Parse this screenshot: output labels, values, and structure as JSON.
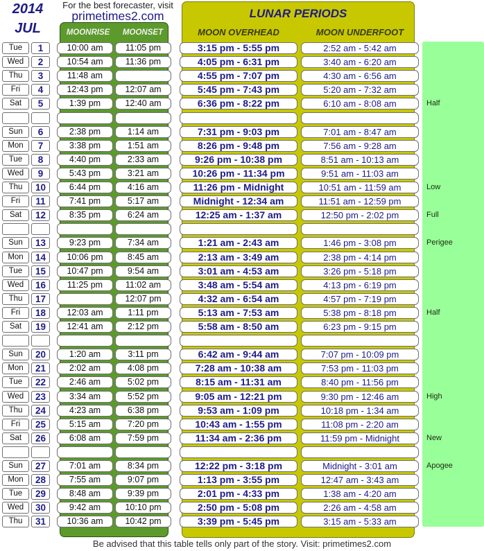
{
  "header": {
    "year": "2014",
    "month": "JUL",
    "promo_text": "For the best forecaster, visit",
    "promo_link": "primetimes2.com"
  },
  "columns": {
    "moonrise": "MOONRISE",
    "moonset": "MOONSET",
    "lunar_title": "LUNAR PERIODS",
    "overhead": "MOON OVERHEAD",
    "underfoot": "MOON UNDERFOOT"
  },
  "rows": [
    {
      "day": "Tue",
      "date": "1",
      "rise": "10:00 am",
      "set": "11:05 pm",
      "over": "3:15 pm - 5:55 pm",
      "under": "2:52 am - 5:42 am"
    },
    {
      "day": "Wed",
      "date": "2",
      "rise": "10:54 am",
      "set": "11:36 pm",
      "over": "4:05 pm - 6:31 pm",
      "under": "3:40 am - 6:20 am"
    },
    {
      "day": "Thu",
      "date": "3",
      "rise": "11:48 am",
      "set": "",
      "over": "4:55 pm - 7:07 pm",
      "under": "4:30 am - 6:56 am"
    },
    {
      "day": "Fri",
      "date": "4",
      "rise": "12:43 pm",
      "set": "12:07 am",
      "over": "5:45 pm - 7:43 pm",
      "under": "5:20 am - 7:32 am"
    },
    {
      "day": "Sat",
      "date": "5",
      "rise": "1:39 pm",
      "set": "12:40 am",
      "over": "6:36 pm - 8:22 pm",
      "under": "6:10 am - 8:08 am"
    },
    {
      "day": "",
      "date": "",
      "rise": "",
      "set": "",
      "over": "",
      "under": ""
    },
    {
      "day": "Sun",
      "date": "6",
      "rise": "2:38 pm",
      "set": "1:14 am",
      "over": "7:31 pm - 9:03 pm",
      "under": "7:01 am - 8:47 am"
    },
    {
      "day": "Mon",
      "date": "7",
      "rise": "3:38 pm",
      "set": "1:51 am",
      "over": "8:26 pm - 9:48 pm",
      "under": "7:56 am - 9:28 am"
    },
    {
      "day": "Tue",
      "date": "8",
      "rise": "4:40 pm",
      "set": "2:33 am",
      "over": "9:26 pm - 10:38 pm",
      "under": "8:51 am - 10:13 am"
    },
    {
      "day": "Wed",
      "date": "9",
      "rise": "5:43 pm",
      "set": "3:21 am",
      "over": "10:26 pm - 11:34 pm",
      "under": "9:51 am - 11:03 am"
    },
    {
      "day": "Thu",
      "date": "10",
      "rise": "6:44 pm",
      "set": "4:16 am",
      "over": "11:26 pm - Midnight",
      "under": "10:51 am - 11:59 am"
    },
    {
      "day": "Fri",
      "date": "11",
      "rise": "7:41 pm",
      "set": "5:17 am",
      "over": "Midnight - 12:34 am",
      "under": "11:51 am - 12:59 pm"
    },
    {
      "day": "Sat",
      "date": "12",
      "rise": "8:35 pm",
      "set": "6:24 am",
      "over": "12:25 am - 1:37 am",
      "under": "12:50 pm - 2:02 pm"
    },
    {
      "day": "",
      "date": "",
      "rise": "",
      "set": "",
      "over": "",
      "under": ""
    },
    {
      "day": "Sun",
      "date": "13",
      "rise": "9:23 pm",
      "set": "7:34 am",
      "over": "1:21 am - 2:43 am",
      "under": "1:46 pm - 3:08 pm"
    },
    {
      "day": "Mon",
      "date": "14",
      "rise": "10:06 pm",
      "set": "8:45 am",
      "over": "2:13 am - 3:49 am",
      "under": "2:38 pm - 4:14 pm"
    },
    {
      "day": "Tue",
      "date": "15",
      "rise": "10:47 pm",
      "set": "9:54 am",
      "over": "3:01 am - 4:53 am",
      "under": "3:26 pm - 5:18 pm"
    },
    {
      "day": "Wed",
      "date": "16",
      "rise": "11:25 pm",
      "set": "11:02 am",
      "over": "3:48 am - 5:54 am",
      "under": "4:13 pm - 6:19 pm"
    },
    {
      "day": "Thu",
      "date": "17",
      "rise": "",
      "set": "12:07 pm",
      "over": "4:32 am - 6:54 am",
      "under": "4:57 pm - 7:19 pm"
    },
    {
      "day": "Fri",
      "date": "18",
      "rise": "12:03 am",
      "set": "1:11 pm",
      "over": "5:13 am - 7:53 am",
      "under": "5:38 pm - 8:18 pm"
    },
    {
      "day": "Sat",
      "date": "19",
      "rise": "12:41 am",
      "set": "2:12 pm",
      "over": "5:58 am - 8:50 am",
      "under": "6:23 pm - 9:15 pm"
    },
    {
      "day": "",
      "date": "",
      "rise": "",
      "set": "",
      "over": "",
      "under": ""
    },
    {
      "day": "Sun",
      "date": "20",
      "rise": "1:20 am",
      "set": "3:11 pm",
      "over": "6:42 am - 9:44 am",
      "under": "7:07 pm - 10:09 pm"
    },
    {
      "day": "Mon",
      "date": "21",
      "rise": "2:02 am",
      "set": "4:08 pm",
      "over": "7:28 am - 10:38 am",
      "under": "7:53 pm - 11:03 pm"
    },
    {
      "day": "Tue",
      "date": "22",
      "rise": "2:46 am",
      "set": "5:02 pm",
      "over": "8:15 am - 11:31 am",
      "under": "8:40 pm - 11:56 pm"
    },
    {
      "day": "Wed",
      "date": "23",
      "rise": "3:34 am",
      "set": "5:52 pm",
      "over": "9:05 am - 12:21 pm",
      "under": "9:30 pm - 12:46 am"
    },
    {
      "day": "Thu",
      "date": "24",
      "rise": "4:23 am",
      "set": "6:38 pm",
      "over": "9:53 am - 1:09 pm",
      "under": "10:18 pm - 1:34 am"
    },
    {
      "day": "Fri",
      "date": "25",
      "rise": "5:15 am",
      "set": "7:20 pm",
      "over": "10:43 am - 1:55 pm",
      "under": "11:08 pm - 2:20 am"
    },
    {
      "day": "Sat",
      "date": "26",
      "rise": "6:08 am",
      "set": "7:59 pm",
      "over": "11:34 am - 2:36 pm",
      "under": "11:59 pm - Midnight"
    },
    {
      "day": "",
      "date": "",
      "rise": "",
      "set": "",
      "over": "",
      "under": ""
    },
    {
      "day": "Sun",
      "date": "27",
      "rise": "7:01 am",
      "set": "8:34 pm",
      "over": "12:22 pm - 3:18 pm",
      "under": "Midnight - 3:01 am"
    },
    {
      "day": "Mon",
      "date": "28",
      "rise": "7:55 am",
      "set": "9:07 pm",
      "over": "1:13 pm - 3:55 pm",
      "under": "12:47 am - 3:43 am"
    },
    {
      "day": "Tue",
      "date": "29",
      "rise": "8:48 am",
      "set": "9:39 pm",
      "over": "2:01 pm - 4:33 pm",
      "under": "1:38 am - 4:20 am"
    },
    {
      "day": "Wed",
      "date": "30",
      "rise": "9:42 am",
      "set": "10:10 pm",
      "over": "2:50 pm - 5:08 pm",
      "under": "2:26 am - 4:58 am"
    },
    {
      "day": "Thu",
      "date": "31",
      "rise": "10:36 am",
      "set": "10:42 pm",
      "over": "3:39 pm - 5:45 pm",
      "under": "3:15 am - 5:33 am"
    }
  ],
  "side_notes": [
    {
      "row": 4,
      "label": "Half"
    },
    {
      "row": 10,
      "label": "Low"
    },
    {
      "row": 12,
      "label": "Full"
    },
    {
      "row": 14,
      "label": "Perigee"
    },
    {
      "row": 19,
      "label": "Half"
    },
    {
      "row": 25,
      "label": "High"
    },
    {
      "row": 28,
      "label": "New"
    },
    {
      "row": 30,
      "label": "Apogee"
    }
  ],
  "footer": "Be advised that this table tells only part of the story.  Visit: primetimes2.com"
}
